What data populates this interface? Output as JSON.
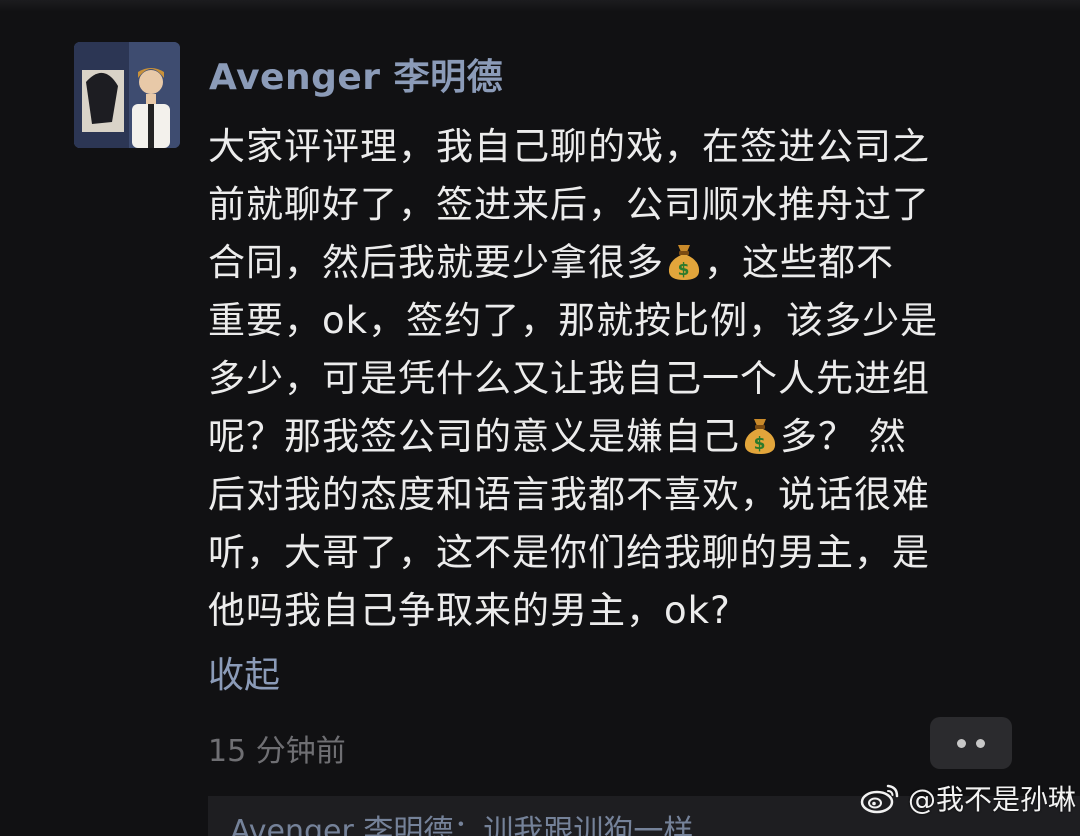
{
  "comment": {
    "author": "Avenger 李明德",
    "lines": [
      [
        "大家评评理，我自己聊的戏，在签进公司之"
      ],
      [
        "前就聊好了，签进来后，公司顺水推舟过了"
      ],
      [
        "合同，然后我就要少拿很多",
        "，这些都不"
      ],
      [
        "重要，ok，签约了，那就按比例，该多少是"
      ],
      [
        "多少，可是凭什么又让我自己一个人先进组"
      ],
      [
        "呢？那我签公司的意义是嫌自己",
        "多？ 然"
      ],
      [
        "后对我的态度和语言我都不喜欢，说话很难"
      ],
      [
        "听，大哥了，这不是你们给我聊的男主，是"
      ],
      [
        "他吗我自己争取来的男主，ok?"
      ]
    ],
    "collapse_label": "收起",
    "timestamp": "15 分钟前",
    "more_icon": "more-dots-icon",
    "emoji_icon": "money-bag-icon"
  },
  "reply_preview": "Avenger 李明德：训我跟训狗一样",
  "watermark": "@我不是孙琳",
  "colors": {
    "background": "#111113",
    "text": "#ececec",
    "author": "#8b9bb8",
    "secondary": "#6f6f73"
  }
}
